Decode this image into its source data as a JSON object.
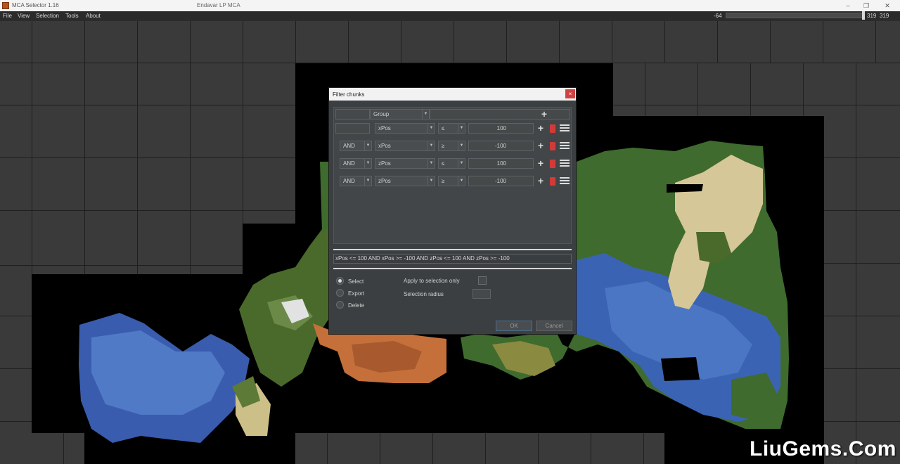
{
  "window": {
    "app_name": "MCA Selector 1.16",
    "document_title": "Endavar LP MCA",
    "minimize": "–",
    "maximize": "❐",
    "close": "✕"
  },
  "menu": {
    "items": [
      "File",
      "View",
      "Selection",
      "Tools",
      "About"
    ]
  },
  "height_slider": {
    "min_label": "-64",
    "value_label": "319",
    "max_label": "319",
    "fraction": 1.0
  },
  "dialog": {
    "title": "Filter chunks",
    "close_glyph": "×",
    "group": {
      "label": "Group",
      "add_glyph": "+"
    },
    "filters": [
      {
        "operator": "",
        "field": "xPos",
        "comparator": "≤",
        "value": "100"
      },
      {
        "operator": "AND",
        "field": "xPos",
        "comparator": "≥",
        "value": "-100"
      },
      {
        "operator": "AND",
        "field": "zPos",
        "comparator": "≤",
        "value": "100"
      },
      {
        "operator": "AND",
        "field": "zPos",
        "comparator": "≥",
        "value": "-100"
      }
    ],
    "query": "xPos <= 100 AND xPos >= -100 AND zPos <= 100 AND zPos >= -100",
    "actions": {
      "options": [
        "Select",
        "Export",
        "Delete"
      ],
      "selected": "Select"
    },
    "apply_to_selection_label": "Apply to selection only",
    "selection_radius_label": "Selection radius",
    "ok_label": "OK",
    "cancel_label": "Cancel"
  },
  "colors": {
    "ocean": "#3a5fb0",
    "forest": "#3f6b2e",
    "desert": "#d7c89a",
    "mesa": "#c8733a",
    "snow": "#e8e8e8"
  },
  "watermark": "LiuGems.Com"
}
